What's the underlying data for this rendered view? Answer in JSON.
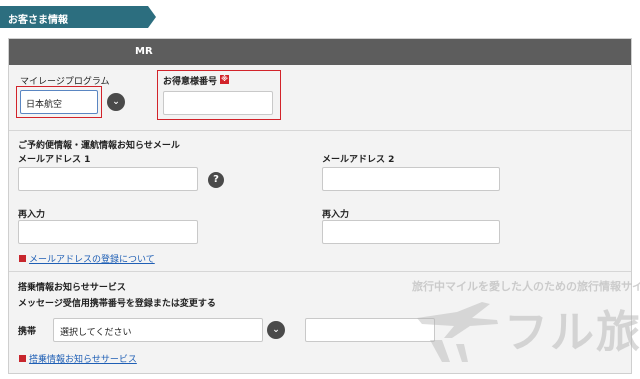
{
  "header": {
    "title": "お客さま情報"
  },
  "member": {
    "name": "MR"
  },
  "mileage": {
    "program_label": "マイレージプログラム",
    "program_value": "日本航空",
    "member_number_label": "お得意様番号",
    "required_mark": "※",
    "member_number_value": ""
  },
  "notification_email": {
    "section_title": "ご予約便情報・運航情報お知らせメール",
    "email1_label": "メールアドレス 1",
    "email2_label": "メールアドレス 2",
    "reenter_label_1": "再入力",
    "reenter_label_2": "再入力",
    "help_glyph": "?",
    "email_link": "メールアドレスの登録について"
  },
  "boarding": {
    "section_title": "搭乗情報お知らせサービス",
    "subtitle": "メッセージ受信用携帯番号を登録または変更する",
    "mobile_label": "携帯",
    "mobile_select_value": "選択してください",
    "mobile_number_value": "",
    "link": "搭乗情報お知らせサービス"
  },
  "watermark": {
    "tagline": "旅行中マイルを愛した人のための旅行情報サイト",
    "brand": "フル旅"
  },
  "colors": {
    "header_teal": "#2c6e7f",
    "bar_gray": "#5d5d5d",
    "required_red": "#d2232a",
    "link_blue": "#1f5fb5"
  }
}
